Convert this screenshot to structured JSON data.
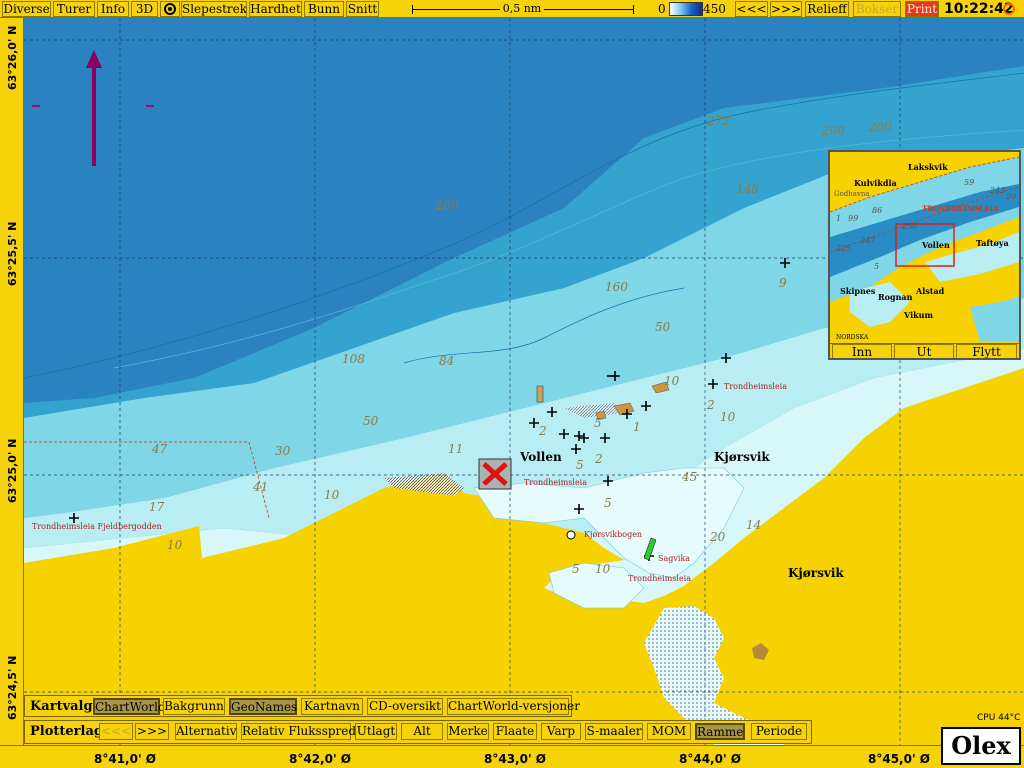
{
  "menu": {
    "items": [
      {
        "label": "Diverse"
      },
      {
        "label": "Turer"
      },
      {
        "label": "Info"
      },
      {
        "label": "3D"
      },
      {
        "label": "Slepestrek"
      },
      {
        "label": "Hardhet"
      },
      {
        "label": "Bunn"
      },
      {
        "label": "Snitt"
      }
    ],
    "scale_label": "0,5 nm",
    "depth_min": "0",
    "depth_max": "450",
    "prev_label": "<<<",
    "next_label": ">>>",
    "relief_label": "Relieff",
    "bokser_label": "Bokser",
    "print_label": "Print",
    "clock": "10:22:42"
  },
  "latitude_labels": [
    "63°26,0' N",
    "63°25,5' N",
    "63°25,0' N",
    "63°24,5' N"
  ],
  "longitude_labels": [
    "8°41,0' Ø",
    "8°42,0' Ø",
    "8°43,0' Ø",
    "8°44,0' Ø",
    "8°45,0' Ø"
  ],
  "map": {
    "places": {
      "vollen": "Vollen",
      "kjorsvik_1": "Kjørsvik",
      "kjorsvik_2": "Kjørsvik"
    },
    "depths": [
      "272",
      "200",
      "200",
      "148",
      "260",
      "160",
      "50",
      "108",
      "84",
      "50",
      "11",
      "30",
      "47",
      "41",
      "17",
      "10",
      "45",
      "20",
      "14",
      "10",
      "9",
      "5",
      "5",
      "2",
      "1",
      "2",
      "5",
      "10",
      "10",
      "2",
      "5",
      "10"
    ],
    "small_labels": {
      "fjeld": "Trondheimsleia Fjeldbergodden",
      "trond1": "Trondheimsleia",
      "trond2": "Trondheimsleia",
      "trond3": "Trondheimsleia",
      "kjorsvikbogen": "Kjørsvikbogen",
      "sagvik": "Sagvika"
    }
  },
  "inset": {
    "places": [
      "Lakskvik",
      "Kulvikdla",
      "Godhavna",
      "TRONDHEIMSLEIA",
      "Vollen",
      "Taftøya",
      "Skipnes",
      "Rognan",
      "Alstad",
      "Vikum",
      "NORDSKA"
    ],
    "depths": [
      "59",
      "243",
      "86",
      "99",
      "1",
      "250",
      "247",
      "225",
      "5",
      "20"
    ],
    "buttons": {
      "in": "Inn",
      "out": "Ut",
      "move": "Flytt"
    }
  },
  "kartvalg": {
    "label": "Kartvalg",
    "buttons": [
      {
        "label": "ChartWorld",
        "active": true
      },
      {
        "label": "Bakgrunn",
        "active": false
      },
      {
        "label": "GeoNames",
        "active": true
      },
      {
        "label": "Kartnavn",
        "active": false
      },
      {
        "label": "CD-oversikt",
        "active": false
      },
      {
        "label": "ChartWorld-versjoner",
        "active": false
      }
    ]
  },
  "plotterlag": {
    "label": "Plotterlag",
    "buttons": [
      {
        "label": "<<<",
        "dim": true
      },
      {
        "label": ">>>"
      },
      {
        "label": "Alternativ"
      },
      {
        "label": "Relativ Fluksspred"
      },
      {
        "label": "Utlagt"
      },
      {
        "label": "Alt"
      },
      {
        "label": "Merke"
      },
      {
        "label": "Flaate"
      },
      {
        "label": "Varp"
      },
      {
        "label": "S-maaler"
      },
      {
        "label": "MOM"
      },
      {
        "label": "Ramme",
        "active": true
      },
      {
        "label": "Periode"
      }
    ]
  },
  "status": {
    "cpu": "CPU 44°C",
    "brand": "Olex"
  },
  "colors": {
    "land": "#f5d200",
    "deep": "#2a8cc4",
    "mid": "#3aa8d0",
    "shallow": "#7fd6e4",
    "very_shallow": "#bff0f2",
    "foreshore": "#e6fbfb"
  }
}
